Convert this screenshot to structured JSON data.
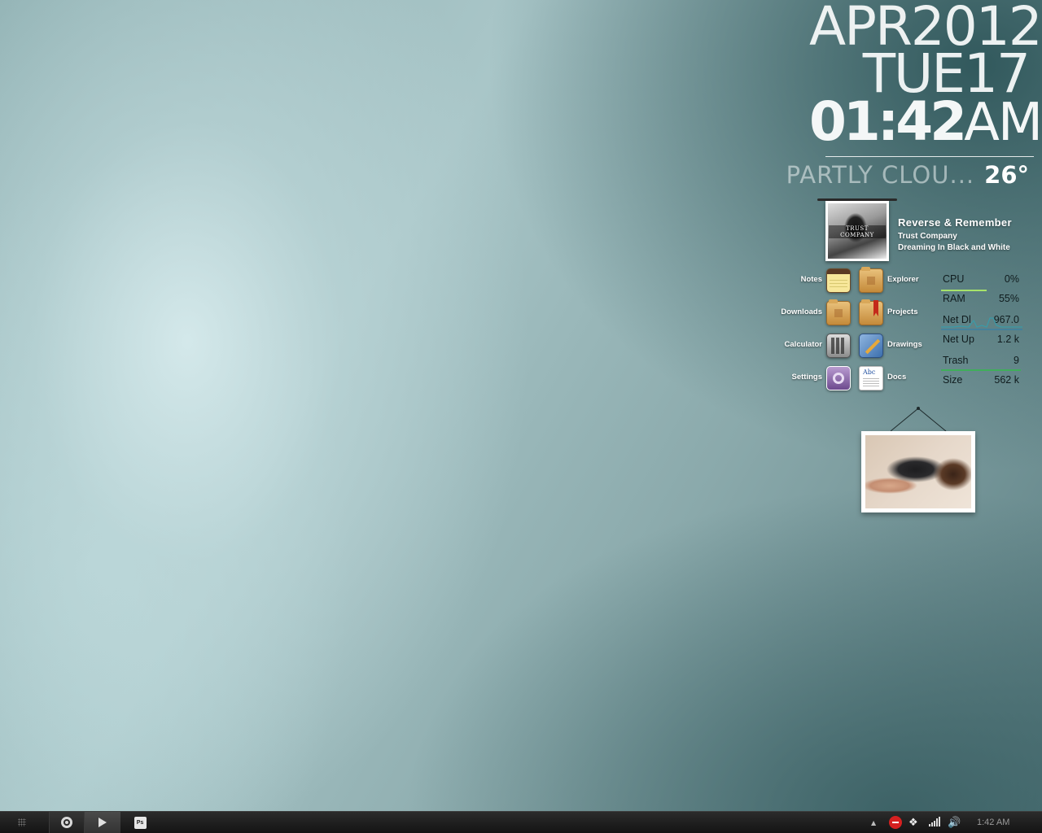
{
  "clock": {
    "month_year": "APR2012",
    "day": "TUE17",
    "time": "01:42",
    "ampm": "AM"
  },
  "weather": {
    "condition": "PARTLY CLOU...",
    "temperature": "26°"
  },
  "now_playing": {
    "cover_text": "TRUST COMPANY",
    "title": "Reverse & Remember",
    "artist": "Trust Company",
    "album": "Dreaming In Black and White"
  },
  "launcher": {
    "notes": "Notes",
    "explorer": "Explorer",
    "downloads": "Downloads",
    "projects": "Projects",
    "calculator": "Calculator",
    "drawings": "Drawings",
    "settings": "Settings",
    "docs": "Docs",
    "docs_icon_text": "Abc"
  },
  "stats": [
    {
      "label": "CPU",
      "value": "0%"
    },
    {
      "label": "RAM",
      "value": "55%"
    },
    {
      "label": "Net Dl",
      "value": "967.0"
    },
    {
      "label": "Net Up",
      "value": "1.2 k"
    },
    {
      "label": "Trash",
      "value": "9"
    },
    {
      "label": "Size",
      "value": "562 k"
    }
  ],
  "taskbar": {
    "ps_label": "Ps",
    "clock": "1:42 AM"
  },
  "colors": {
    "stat_ram_line": "#a6e36a",
    "stat_net_line": "#2a7fb0",
    "stat_trash_line": "#3fae5a"
  }
}
